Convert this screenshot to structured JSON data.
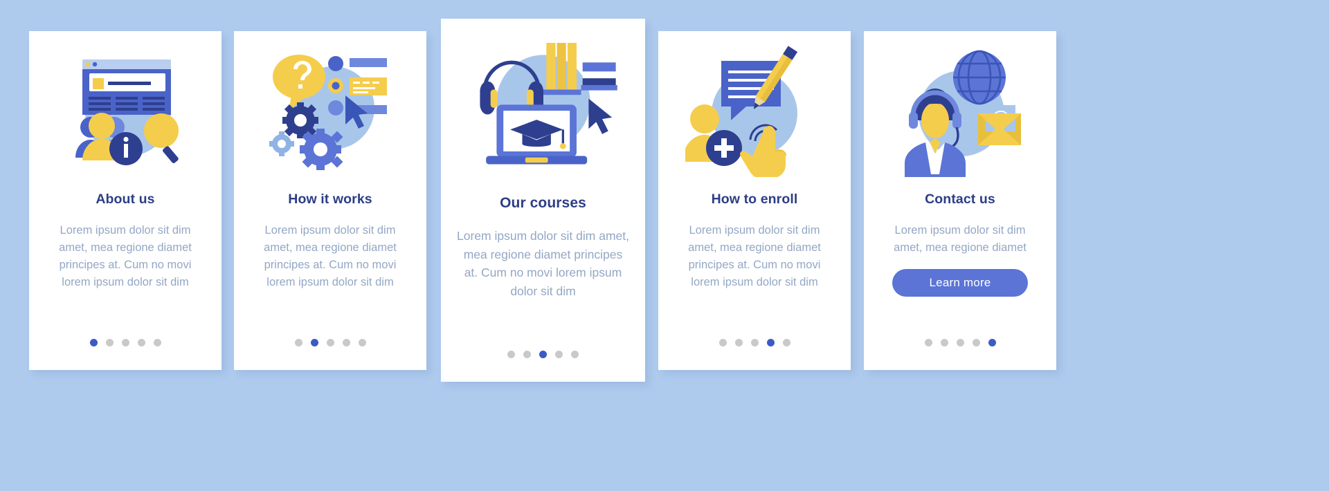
{
  "theme": {
    "background": "#aecbee",
    "card_background": "#ffffff",
    "title_color": "#2c3e87",
    "body_color": "#93a7c4",
    "accent_blue": "#5b74d6",
    "active_dot": "#3c5bc4",
    "inactive_dot": "#c9c9c9",
    "yellow": "#f5cd4c",
    "deep_navy": "#2e3f8f",
    "soft_blue": "#a8c6ea"
  },
  "dot_count": 5,
  "cards": [
    {
      "id": "about-us",
      "title": "About us",
      "body": "Lorem ipsum dolor sit dim amet, mea regione diamet principes at. Cum no movi lorem ipsum dolor sit dim",
      "illustration": "browser-users-info-magnifier",
      "active_dot_index": 0,
      "featured": false,
      "cta": null
    },
    {
      "id": "how-it-works",
      "title": "How it works",
      "body": "Lorem ipsum dolor sit dim amet, mea regione diamet principes at. Cum no movi lorem ipsum dolor sit dim",
      "illustration": "question-bubble-gears-cursor",
      "active_dot_index": 1,
      "featured": false,
      "cta": null
    },
    {
      "id": "our-courses",
      "title": "Our courses",
      "body": "Lorem ipsum dolor sit dim amet, mea regione diamet principes at. Cum no movi lorem ipsum dolor sit dim",
      "illustration": "headphones-books-laptop-graduation-cap",
      "active_dot_index": 2,
      "featured": true,
      "cta": null
    },
    {
      "id": "how-to-enroll",
      "title": "How to enroll",
      "body": "Lorem ipsum dolor sit dim amet, mea regione diamet principes at. Cum no movi lorem ipsum dolor sit dim",
      "illustration": "add-user-form-pencil-tap-hand",
      "active_dot_index": 3,
      "featured": false,
      "cta": null
    },
    {
      "id": "contact-us",
      "title": "Contact us",
      "body": "Lorem ipsum dolor sit dim amet, mea regione diamet",
      "illustration": "globe-headset-operator-email",
      "active_dot_index": 4,
      "featured": false,
      "cta": "Learn more"
    }
  ]
}
